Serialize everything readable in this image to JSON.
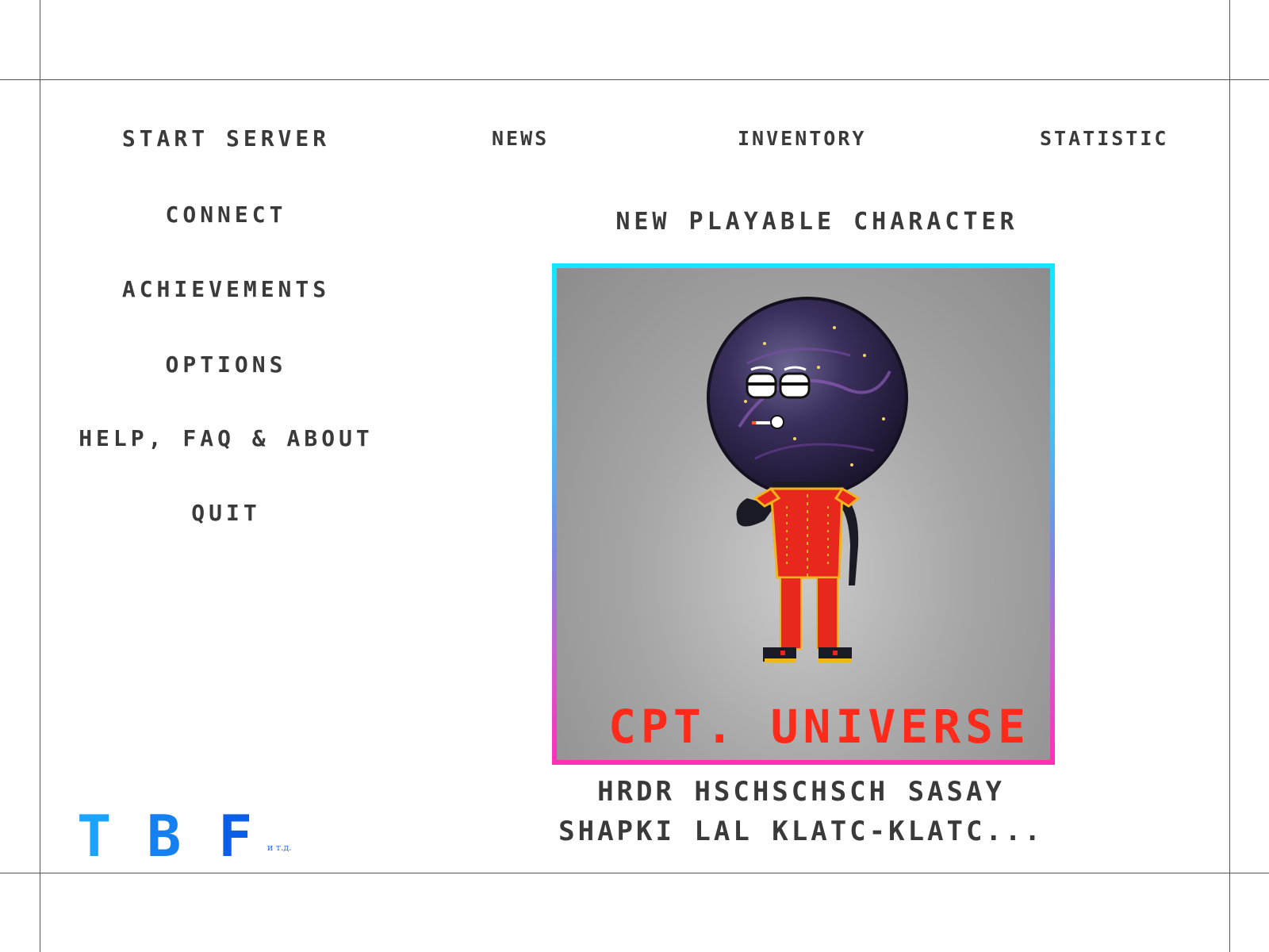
{
  "menu": {
    "items": [
      {
        "label": "START SERVER"
      },
      {
        "label": "CONNECT"
      },
      {
        "label": "ACHIEVEMENTS"
      },
      {
        "label": "OPTIONS"
      },
      {
        "label": "HELP, FAQ & ABOUT"
      },
      {
        "label": "QUIT"
      }
    ]
  },
  "tabs": {
    "news": "NEWS",
    "inventory": "INVENTORY",
    "statistic": "STATISTIC"
  },
  "news": {
    "heading": "NEW PLAYABLE CHARACTER",
    "character_name": "CPT. UNIVERSE",
    "description_line1": "HRDR HSCHSCHSCH SASAY",
    "description_line2": "SHAPKI LAL KLATC-KLATC..."
  },
  "logo": {
    "letter1": "T",
    "letter2": "B",
    "letter3": "F",
    "suffix": "и т.д."
  },
  "colors": {
    "text": "#3a3a3a",
    "name_red": "#ff2a1a",
    "frame_top": "#14e6ff",
    "frame_bottom": "#ff2fb5",
    "logo_light": "#1aa3ff",
    "logo_dark": "#0b5fe6"
  }
}
